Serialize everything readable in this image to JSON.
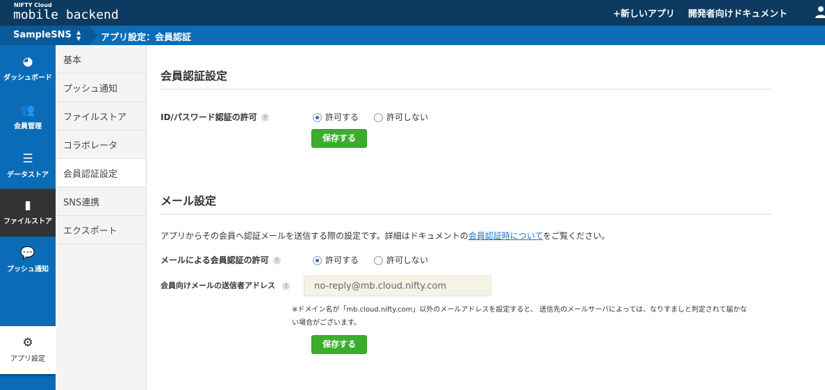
{
  "header": {
    "logo_small": "NIFTY Cloud",
    "logo": "mobile backend",
    "new_app": "+新しいアプリ",
    "docs": "開発者向けドキュメント"
  },
  "breadcrumb": {
    "app_name": "SampleSNS",
    "page": "アプリ設定：会員認証"
  },
  "sidebar": {
    "items": [
      {
        "label": "ダッシュボード",
        "icon": "dashboard-icon"
      },
      {
        "label": "会員管理",
        "icon": "users-icon"
      },
      {
        "label": "データストア",
        "icon": "database-icon"
      },
      {
        "label": "ファイルストア",
        "icon": "file-icon"
      },
      {
        "label": "プッシュ通知",
        "icon": "chat-bubble-icon"
      },
      {
        "label": "アプリ設定",
        "icon": "gears-icon"
      }
    ]
  },
  "submenu": {
    "items": [
      "基本",
      "プッシュ通知",
      "ファイルストア",
      "コラボレータ",
      "会員認証設定",
      "SNS連携",
      "エクスポート"
    ]
  },
  "section1": {
    "title": "会員認証設定",
    "label": "ID/パスワード認証の許可",
    "allow": "許可する",
    "deny": "許可しない",
    "save": "保存する"
  },
  "section2": {
    "title": "メール設定",
    "desc_pre": "アプリからその会員へ認証メールを送信する際の設定です。詳細はドキュメントの",
    "desc_link": "会員認証時について",
    "desc_post": "をご覧ください。",
    "label": "メールによる会員認証の許可",
    "allow": "許可する",
    "deny": "許可しない",
    "sender_label": "会員向けメールの送信者アドレス",
    "sender_value": "no-reply@mb.cloud.nifty.com",
    "note": "※ドメイン名が「mb.cloud.nifty.com」以外のメールアドレスを設定すると、 送信先のメールサーバによっては、なりすましと判定されて届かない場合がございます。",
    "save": "保存する"
  },
  "help": "?"
}
